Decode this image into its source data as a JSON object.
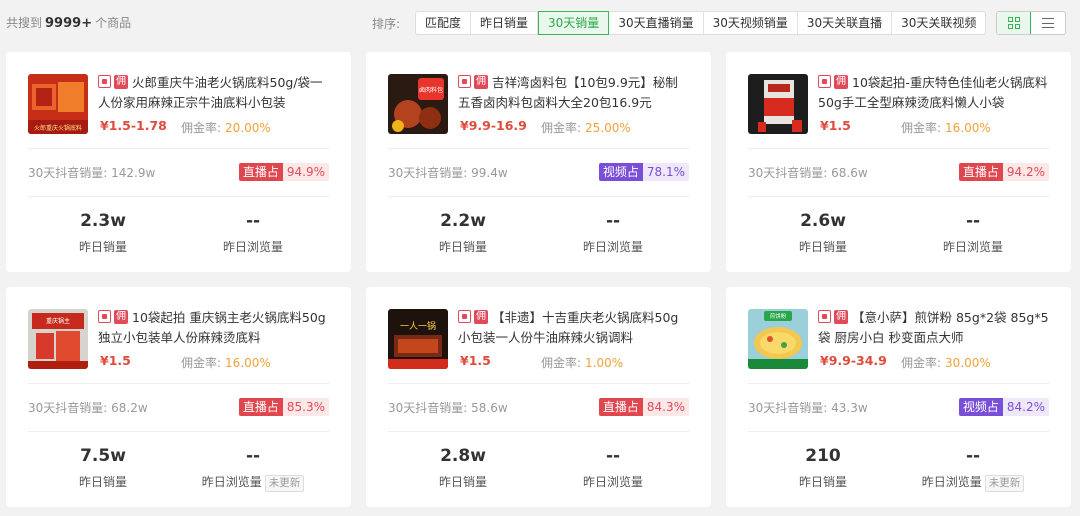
{
  "header": {
    "summary_prefix": "共搜到",
    "summary_count": "9999+",
    "summary_suffix": "个商品",
    "sort_label": "排序:",
    "sort_tabs": [
      "匹配度",
      "昨日销量",
      "30天销量",
      "30天直播销量",
      "30天视频销量",
      "30天关联直播",
      "30天关联视频"
    ],
    "active_sort": "30天销量",
    "view_modes": [
      "grid-icon",
      "list-icon"
    ],
    "active_view": "grid"
  },
  "labels": {
    "yong": "佣",
    "commission": "佣金率:",
    "sales30": "30天抖音销量:",
    "yesterday_sales": "昨日销量",
    "yesterday_views": "昨日浏览量",
    "not_updated": "未更新"
  },
  "colors": {
    "accent": "#3cb35a",
    "price": "#e04a3a",
    "commission_rate": "#f0a23a",
    "live": "#e0464e",
    "video": "#7a4fd8"
  },
  "products": [
    {
      "title": "火郎重庆牛油老火锅底料50g/袋一人份家用麻辣正宗牛油底料小包装",
      "price": "¥1.5-1.78",
      "commission_rate": "20.00%",
      "sales30": "142.9w",
      "share_label": "直播占",
      "share_value": "94.9%",
      "share_type": "live",
      "yesterday_sales": "2.3w",
      "yesterday_views": "--",
      "views_status": "",
      "thumb_text": "火郎重庆火锅底料"
    },
    {
      "title": "吉祥湾卤料包【10包9.9元】秘制五香卤肉料包卤料大全20包16.9元",
      "price": "¥9.9-16.9",
      "commission_rate": "25.00%",
      "sales30": "99.4w",
      "share_label": "视频占",
      "share_value": "78.1%",
      "share_type": "video",
      "yesterday_sales": "2.2w",
      "yesterday_views": "--",
      "views_status": "",
      "thumb_text": "卤肉料包"
    },
    {
      "title": "10袋起拍-重庆特色佳仙老火锅底料50g手工全型麻辣烫底料懒人小袋",
      "price": "¥1.5",
      "commission_rate": "16.00%",
      "sales30": "68.6w",
      "share_label": "直播占",
      "share_value": "94.2%",
      "share_type": "live",
      "yesterday_sales": "2.6w",
      "yesterday_views": "--",
      "views_status": "",
      "thumb_text": ""
    },
    {
      "title": "10袋起拍 重庆锅主老火锅底料50g独立小包装单人份麻辣烫底料",
      "price": "¥1.5",
      "commission_rate": "16.00%",
      "sales30": "68.2w",
      "share_label": "直播占",
      "share_value": "85.3%",
      "share_type": "live",
      "yesterday_sales": "7.5w",
      "yesterday_views": "--",
      "views_status": "未更新",
      "thumb_text": "重庆锅主"
    },
    {
      "title": "【非遗】十吉重庆老火锅底料50g小包装一人份牛油麻辣火锅调料",
      "price": "¥1.5",
      "commission_rate": "1.00%",
      "sales30": "58.6w",
      "share_label": "直播占",
      "share_value": "84.3%",
      "share_type": "live",
      "yesterday_sales": "2.8w",
      "yesterday_views": "--",
      "views_status": "",
      "thumb_text": "一人一锅"
    },
    {
      "title": "【意小萨】煎饼粉 85g*2袋 85g*5袋 厨房小白 秒变面点大师",
      "price": "¥9.9-34.9",
      "commission_rate": "30.00%",
      "sales30": "43.3w",
      "share_label": "视频占",
      "share_value": "84.2%",
      "share_type": "video",
      "yesterday_sales": "210",
      "yesterday_views": "--",
      "views_status": "未更新",
      "thumb_text": "煎饼粉"
    }
  ]
}
